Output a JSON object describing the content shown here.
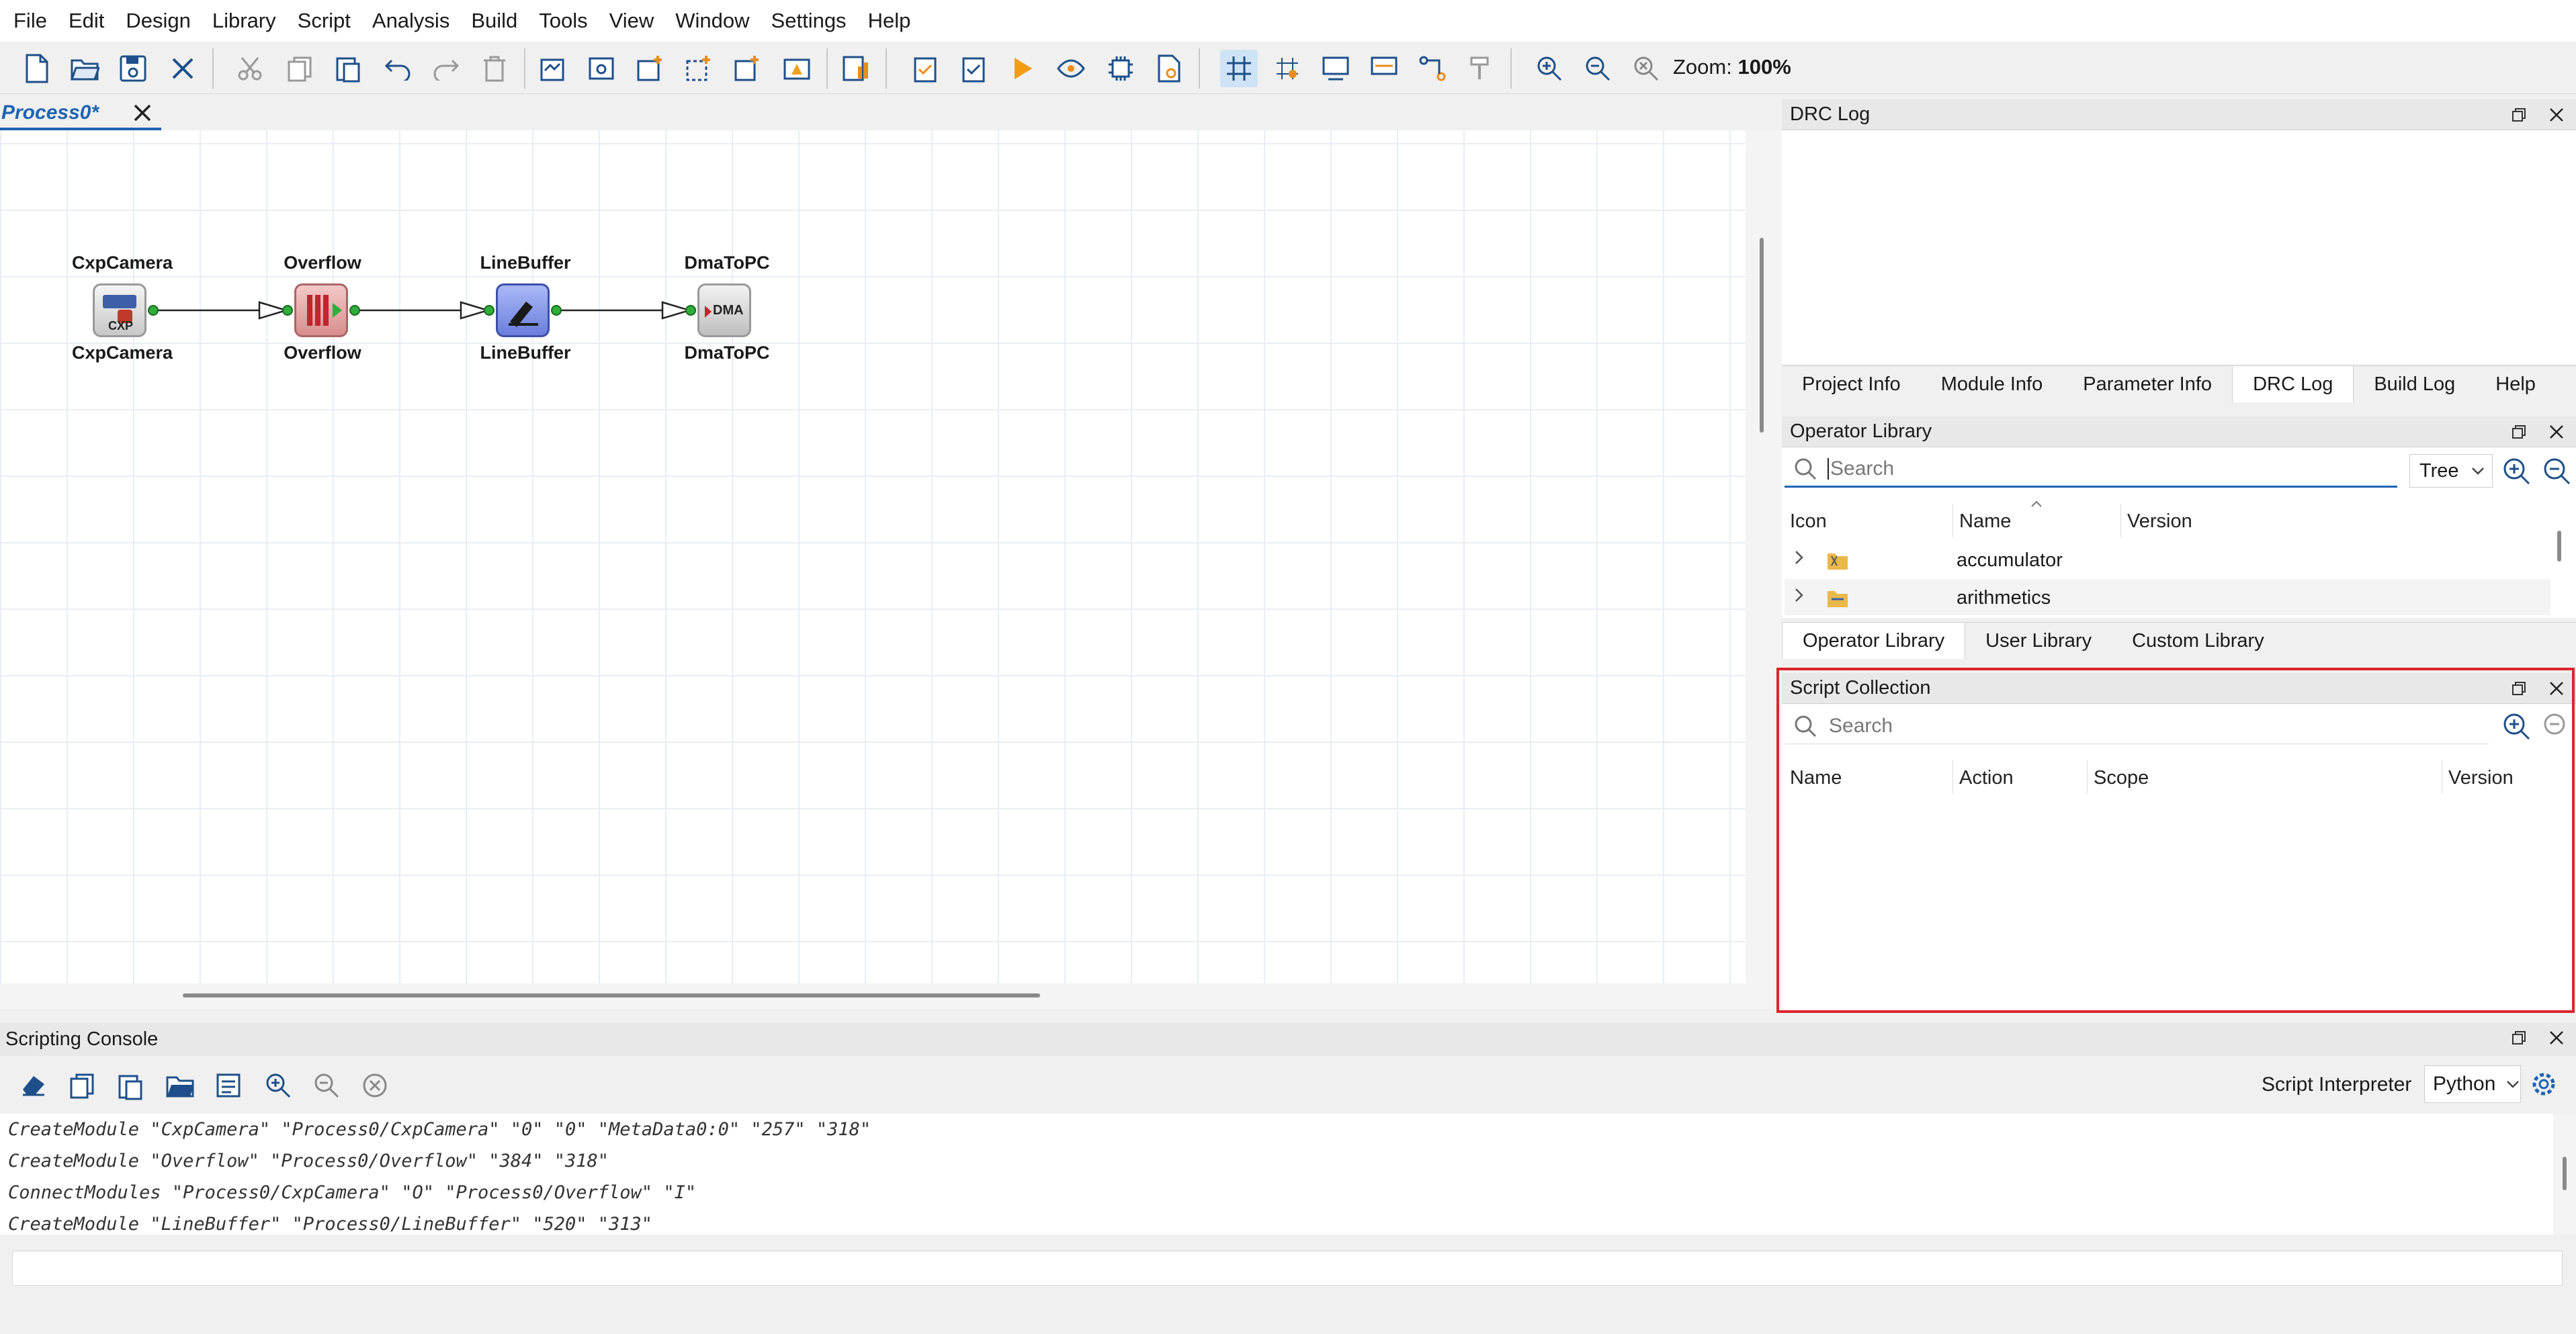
{
  "menu": [
    "File",
    "Edit",
    "Design",
    "Library",
    "Script",
    "Analysis",
    "Build",
    "Tools",
    "View",
    "Window",
    "Settings",
    "Help"
  ],
  "toolbar": {
    "zoom_prefix": "Zoom:",
    "zoom_value": "100%",
    "icons": [
      "new-file-icon",
      "open-folder-icon",
      "save-icon",
      "close-icon",
      "cut-icon",
      "copy-icon",
      "paste-icon",
      "undo-icon",
      "redo-icon",
      "delete-icon",
      "add-module-icon",
      "preview-icon",
      "new-window-icon",
      "select-icon",
      "add-box-icon",
      "warning-icon",
      "report-icon",
      "clipboard-check-icon",
      "clipboard-verify-icon",
      "run-icon",
      "debug-icon",
      "chip-icon",
      "build-file-icon",
      "grid-icon",
      "snap-icon",
      "layout-icon",
      "connect-icon",
      "route-icon",
      "format-brush-icon",
      "zoom-in-icon",
      "zoom-out-icon",
      "zoom-reset-icon"
    ]
  },
  "document_tab": {
    "label": "Process0*"
  },
  "diagram": {
    "nodes": [
      {
        "top_label": "CxpCamera",
        "bottom_label": "CxpCamera",
        "icon": "camera-icon",
        "icon_text": "CXP",
        "color": "#d8d8d8"
      },
      {
        "top_label": "Overflow",
        "bottom_label": "Overflow",
        "icon": "overflow-icon",
        "icon_text": "",
        "color": "#e5a8a8"
      },
      {
        "top_label": "LineBuffer",
        "bottom_label": "LineBuffer",
        "icon": "linebuffer-icon",
        "icon_text": "",
        "color": "#8ea0e8"
      },
      {
        "top_label": "DmaToPC",
        "bottom_label": "DmaToPC",
        "icon": "dma-icon",
        "icon_text": "DMA",
        "color": "#d8d8d8"
      }
    ]
  },
  "drc_log": {
    "title": "DRC Log"
  },
  "info_tabs": [
    "Project Info",
    "Module Info",
    "Parameter Info",
    "DRC Log",
    "Build Log",
    "Help"
  ],
  "operator_library": {
    "title": "Operator Library",
    "search_placeholder": "Search",
    "view_mode": "Tree",
    "columns": [
      "Icon",
      "Name",
      "Version"
    ],
    "rows": [
      {
        "name": "accumulator",
        "version": ""
      },
      {
        "name": "arithmetics",
        "version": ""
      }
    ]
  },
  "library_tabs": [
    "Operator Library",
    "User Library",
    "Custom Library"
  ],
  "script_collection": {
    "title": "Script Collection",
    "search_placeholder": "Search",
    "columns": [
      "Name",
      "Action",
      "Scope",
      "Version"
    ]
  },
  "console": {
    "title": "Scripting Console",
    "interpreter_label": "Script Interpreter",
    "interpreter_value": "Python",
    "lines": [
      "CreateModule \"CxpCamera\" \"Process0/CxpCamera\" \"0\" \"0\" \"MetaData0:0\" \"257\" \"318\"",
      "CreateModule \"Overflow\" \"Process0/Overflow\" \"384\" \"318\"",
      "ConnectModules \"Process0/CxpCamera\" \"O\" \"Process0/Overflow\" \"I\"",
      "CreateModule \"LineBuffer\" \"Process0/LineBuffer\" \"520\" \"313\""
    ]
  },
  "colors": {
    "accent": "#1e63b3",
    "highlight": "#d9272e",
    "port": "#2fae3a"
  }
}
